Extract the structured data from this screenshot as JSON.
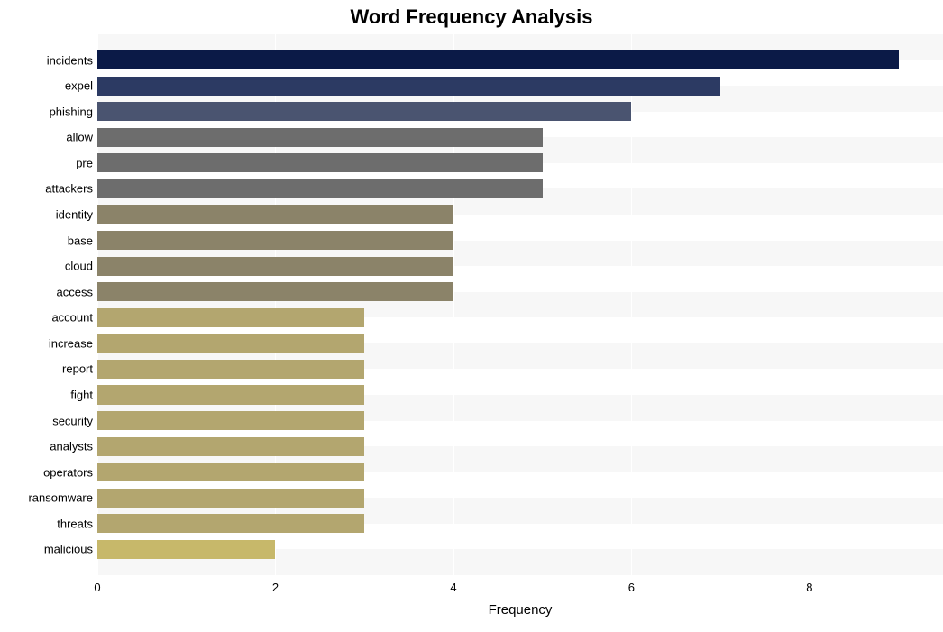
{
  "chart_data": {
    "type": "bar",
    "orientation": "horizontal",
    "title": "Word Frequency Analysis",
    "xlabel": "Frequency",
    "ylabel": "",
    "xlim": [
      0,
      9.5
    ],
    "xticks": [
      0,
      2,
      4,
      6,
      8
    ],
    "categories": [
      "incidents",
      "expel",
      "phishing",
      "allow",
      "pre",
      "attackers",
      "identity",
      "base",
      "cloud",
      "access",
      "account",
      "increase",
      "report",
      "fight",
      "security",
      "analysts",
      "operators",
      "ransomware",
      "threats",
      "malicious"
    ],
    "values": [
      9,
      7,
      6,
      5,
      5,
      5,
      4,
      4,
      4,
      4,
      3,
      3,
      3,
      3,
      3,
      3,
      3,
      3,
      3,
      2
    ],
    "colors": [
      "#0b1a47",
      "#2c3a63",
      "#4a5470",
      "#6d6d6d",
      "#6d6d6d",
      "#6d6d6d",
      "#8b8369",
      "#8b8369",
      "#8b8369",
      "#8b8369",
      "#b3a66f",
      "#b3a66f",
      "#b3a66f",
      "#b3a66f",
      "#b3a66f",
      "#b3a66f",
      "#b3a66f",
      "#b3a66f",
      "#b3a66f",
      "#c7b86a"
    ]
  }
}
